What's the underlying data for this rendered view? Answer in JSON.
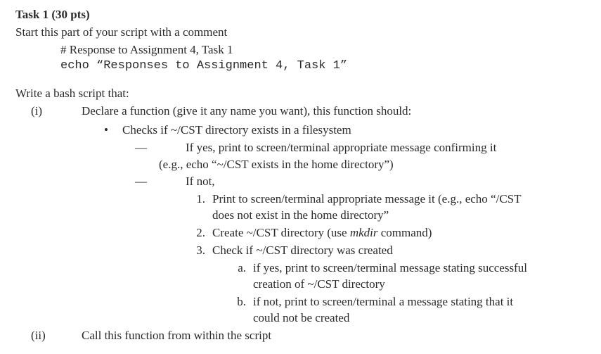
{
  "title": "Task 1 (30 pts)",
  "lead": "Start this part of your script with a comment",
  "code": {
    "comment": "# Response to Assignment 4, Task 1",
    "echo": "echo “Responses to Assignment 4, Task 1”"
  },
  "intro": "Write a bash script that:",
  "items": {
    "i": {
      "marker": "(i)",
      "text": "Declare a function (give it any name you want), this function should:",
      "bullet_marker": "•",
      "bullet_text": "Checks if ~/CST directory exists in a filesystem",
      "dash_marker": "—",
      "yes_text": "If yes, print to screen/terminal appropriate message confirming it",
      "yes_eg": "(e.g., echo “~/CST exists in the home directory”)",
      "no_text": "If not,",
      "steps": {
        "n1": {
          "marker": "1.",
          "l1": "Print to screen/terminal appropriate message it (e.g., echo “/CST",
          "l2": "does not exist in the home directory”"
        },
        "n2": {
          "marker": "2.",
          "text_before": "Create ~/CST directory (use ",
          "mkdir": "mkdir",
          "text_after": " command)"
        },
        "n3": {
          "marker": "3.",
          "text": "Check if ~/CST directory was created",
          "a": {
            "marker": "a.",
            "l1": "if yes, print to screen/terminal message stating successful",
            "l2": "creation of ~/CST directory"
          },
          "b": {
            "marker": "b.",
            "l1": "if not, print to screen/terminal a message stating that it",
            "l2": "could not be created"
          }
        }
      }
    },
    "ii": {
      "marker": "(ii)",
      "text": "Call this function from within the script"
    }
  }
}
